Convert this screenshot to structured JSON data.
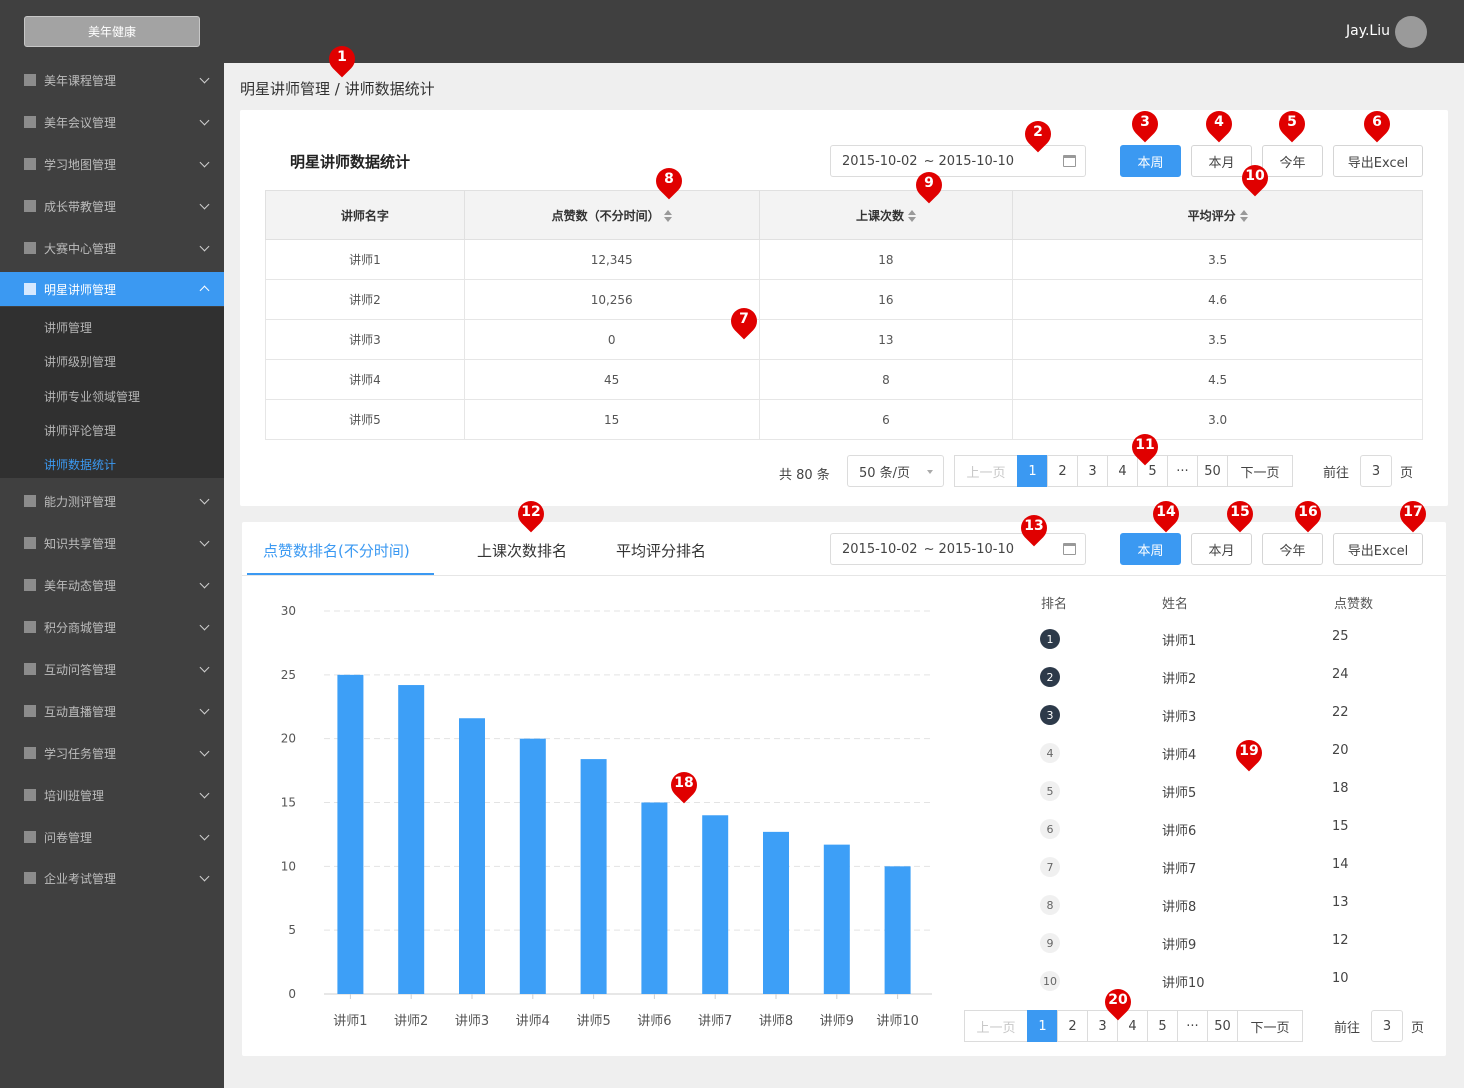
{
  "app": {
    "brand": "美年健康",
    "user_name": "Jay.Liu"
  },
  "sidebar": {
    "items": [
      {
        "label": "美年课程管理"
      },
      {
        "label": "美年会议管理"
      },
      {
        "label": "学习地图管理"
      },
      {
        "label": "成长带教管理"
      },
      {
        "label": "大赛中心管理"
      },
      {
        "label": "明星讲师管理"
      },
      {
        "label": "能力测评管理"
      },
      {
        "label": "知识共享管理"
      },
      {
        "label": "美年动态管理"
      },
      {
        "label": "积分商城管理"
      },
      {
        "label": "互动问答管理"
      },
      {
        "label": "互动直播管理"
      },
      {
        "label": "学习任务管理"
      },
      {
        "label": "培训班管理"
      },
      {
        "label": "问卷管理"
      },
      {
        "label": "企业考试管理"
      }
    ],
    "submenu": [
      {
        "label": "讲师管理"
      },
      {
        "label": "讲师级别管理"
      },
      {
        "label": "讲师专业领域管理"
      },
      {
        "label": "讲师评论管理"
      },
      {
        "label": "讲师数据统计"
      }
    ]
  },
  "breadcrumb": "明星讲师管理 / 讲师数据统计",
  "stats": {
    "title": "明星讲师数据统计",
    "date_from": "2015-10-02",
    "date_sep": "~",
    "date_to": "2015-10-10",
    "buttons": {
      "week": "本周",
      "month": "本月",
      "year": "今年",
      "export": "导出Excel"
    },
    "columns": [
      "讲师名字",
      "点赞数（不分时间）",
      "上课次数",
      "平均评分"
    ],
    "rows": [
      [
        "讲师1",
        "12,345",
        "18",
        "3.5"
      ],
      [
        "讲师2",
        "10,256",
        "16",
        "4.6"
      ],
      [
        "讲师3",
        "0",
        "13",
        "3.5"
      ],
      [
        "讲师4",
        "45",
        "8",
        "4.5"
      ],
      [
        "讲师5",
        "15",
        "6",
        "3.0"
      ]
    ],
    "total": "共 80 条",
    "page_size": "50 条/页",
    "prev": "上一页",
    "next": "下一页",
    "pages": [
      "1",
      "2",
      "3",
      "4",
      "5",
      "···",
      "50"
    ],
    "current_page": "1",
    "goto_label": "前往",
    "goto_value": "3",
    "goto_suffix": "页"
  },
  "ranking": {
    "tabs": [
      "点赞数排名(不分时间)",
      "上课次数排名",
      "平均评分排名"
    ],
    "date_from": "2015-10-02",
    "date_sep": "~",
    "date_to": "2015-10-10",
    "buttons": {
      "week": "本周",
      "month": "本月",
      "year": "今年",
      "export": "导出Excel"
    },
    "headers": {
      "rank": "排名",
      "name": "姓名",
      "likes": "点赞数"
    },
    "list": [
      {
        "rank": "1",
        "name": "讲师1",
        "value": "25"
      },
      {
        "rank": "2",
        "name": "讲师2",
        "value": "24"
      },
      {
        "rank": "3",
        "name": "讲师3",
        "value": "22"
      },
      {
        "rank": "4",
        "name": "讲师4",
        "value": "20"
      },
      {
        "rank": "5",
        "name": "讲师5",
        "value": "18"
      },
      {
        "rank": "6",
        "name": "讲师6",
        "value": "15"
      },
      {
        "rank": "7",
        "name": "讲师7",
        "value": "14"
      },
      {
        "rank": "8",
        "name": "讲师8",
        "value": "13"
      },
      {
        "rank": "9",
        "name": "讲师9",
        "value": "12"
      },
      {
        "rank": "10",
        "name": "讲师10",
        "value": "10"
      }
    ],
    "prev": "上一页",
    "next": "下一页",
    "pages": [
      "1",
      "2",
      "3",
      "4",
      "5",
      "···",
      "50"
    ],
    "current_page": "1",
    "goto_label": "前往",
    "goto_value": "3",
    "goto_suffix": "页"
  },
  "chart_data": {
    "type": "bar",
    "categories": [
      "讲师1",
      "讲师2",
      "讲师3",
      "讲师4",
      "讲师5",
      "讲师6",
      "讲师7",
      "讲师8",
      "讲师9",
      "讲师10"
    ],
    "values": [
      25,
      24.2,
      21.6,
      20,
      18.4,
      15,
      14,
      12.7,
      11.7,
      10
    ],
    "yticks": [
      "0",
      "5",
      "10",
      "15",
      "20",
      "25",
      "30"
    ],
    "ylim": [
      0,
      30
    ],
    "grid": true,
    "bar_color": "#3d9ff7"
  },
  "markers": [
    "1",
    "2",
    "3",
    "4",
    "5",
    "6",
    "7",
    "8",
    "9",
    "10",
    "11",
    "12",
    "13",
    "14",
    "15",
    "16",
    "17",
    "18",
    "19",
    "20"
  ],
  "colors": {
    "accent": "#3b99f2",
    "marker": "#e00000",
    "sidebar_bg": "#404040"
  }
}
